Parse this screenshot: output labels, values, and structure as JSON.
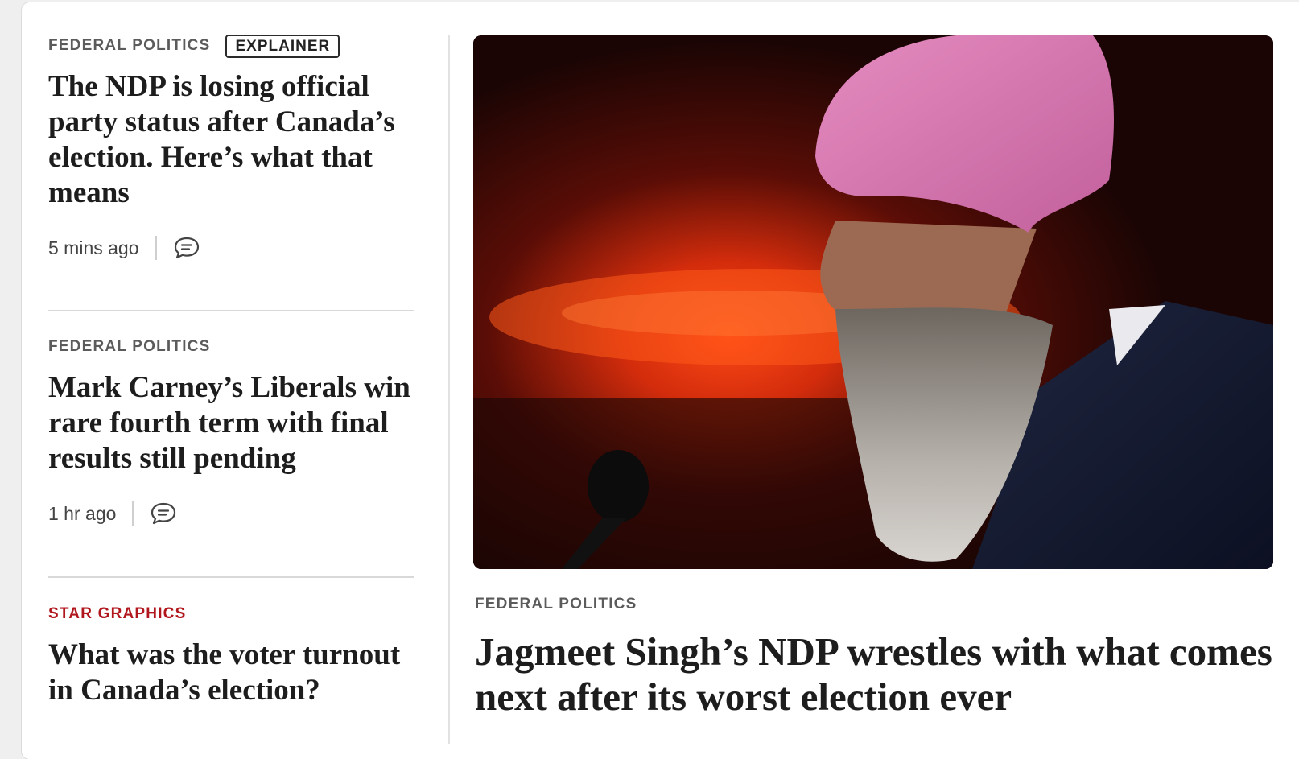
{
  "stories": [
    {
      "kicker": "FEDERAL POLITICS",
      "badge": "EXPLAINER",
      "headline": "The NDP is losing official party status after Canada’s election. Here’s what that means",
      "time": "5 mins ago"
    },
    {
      "kicker": "FEDERAL POLITICS",
      "headline": "Mark Carney’s Liberals win rare fourth term with final results still pending",
      "time": "1 hr ago"
    },
    {
      "kicker": "STAR GRAPHICS",
      "headline": "What was the voter turnout in Canada’s election?"
    }
  ],
  "main": {
    "kicker": "FEDERAL POLITICS",
    "headline": "Jagmeet Singh’s NDP wrestles with what comes next after its worst election ever"
  },
  "icons": {
    "comment": "comment-icon"
  },
  "colors": {
    "kicker": "#5b5b5b",
    "kicker_red": "#b0161c",
    "headline": "#1d1d1d"
  }
}
